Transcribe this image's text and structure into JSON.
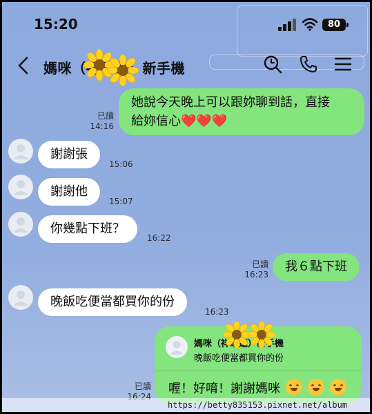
{
  "status_bar": {
    "time": "15:20",
    "battery": "80"
  },
  "header": {
    "title": "媽咪（祥華蓮）新手機"
  },
  "messages": [
    {
      "dir": "out",
      "text_line1": "她說今天晚上可以跟妳聊到話，直接",
      "text_line2": "給妳信心",
      "read": "已讀",
      "time": "14:16",
      "hearts": "❤️❤️❤️"
    },
    {
      "dir": "in",
      "text": "謝謝張",
      "time": "15:06"
    },
    {
      "dir": "in",
      "text": "謝謝他",
      "time": "15:07"
    },
    {
      "dir": "in",
      "text": "你幾點下班？",
      "time": "16:22"
    },
    {
      "dir": "out",
      "text": "我６點下班",
      "read": "已讀",
      "time": "16:23"
    },
    {
      "dir": "in",
      "text": "晚飯吃便當都買你的份",
      "time": "16:23"
    }
  ],
  "reply": {
    "quoted_name": "媽咪（祥華蓮）新手機",
    "quoted_text": "晚飯吃便當都買你的份",
    "body": "喔！好唷！謝謝媽咪",
    "read": "已讀",
    "time": "16:24"
  },
  "watermark": "https://betty835153.pixnet.net/album",
  "colors": {
    "background": "#8ea9de",
    "outgoing_bubble": "#84e47e",
    "incoming_bubble": "#ffffff",
    "heart": "#e5202a"
  }
}
